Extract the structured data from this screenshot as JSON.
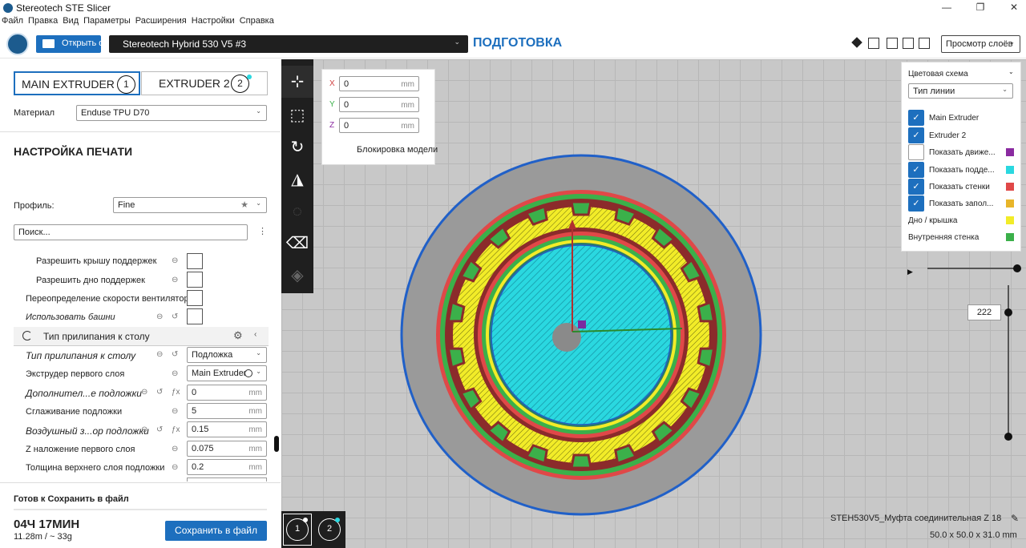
{
  "window": {
    "title": "Stereotech STE Slicer",
    "minimize": "—",
    "maximize": "❐",
    "close": "✕"
  },
  "menu": [
    "Файл",
    "Правка",
    "Вид",
    "Параметры",
    "Расширения",
    "Настройки",
    "Справка"
  ],
  "header": {
    "open_label": "Открыть фа",
    "printer": "Stereotech Hybrid 530 V5 #3",
    "stage": "ПОДГОТОВКА",
    "layer_view": "Просмотр слоёв"
  },
  "extruders": {
    "main": "MAIN EXTRUDER",
    "main_num": "1",
    "second": "EXTRUDER 2",
    "second_num": "2"
  },
  "material": {
    "label": "Материал",
    "value": "Enduse TPU D70"
  },
  "print_settings": {
    "title": "НАСТРОЙКА ПЕЧАТИ",
    "profile_label": "Профиль:",
    "profile_value": "Fine",
    "search_placeholder": "Поиск..."
  },
  "settings": [
    {
      "label": "Разрешить крышу поддержек"
    },
    {
      "label": "Разрешить дно поддержек"
    },
    {
      "label": "Переопределение скорости вентилятора"
    },
    {
      "label": "Использовать башни"
    }
  ],
  "adhesion": {
    "section_title": "Тип прилипания к столу",
    "rows": [
      {
        "label": "Тип прилипания к столу",
        "value": "Подложка"
      },
      {
        "label": "Экструдер первого слоя",
        "value": "Main Extruder"
      },
      {
        "label": "Дополнител...е подложки",
        "value": "0",
        "unit": "mm"
      },
      {
        "label": "Сглаживание подложки",
        "value": "5",
        "unit": "mm"
      },
      {
        "label": "Воздушный з...ор подложки",
        "value": "0.15",
        "unit": "mm"
      },
      {
        "label": "Z наложение первого слоя",
        "value": "0.075",
        "unit": "mm"
      },
      {
        "label": "Толщина верхнего слоя подложки",
        "value": "0.2",
        "unit": "mm"
      }
    ]
  },
  "bottom": {
    "status": "Готов к Сохранить в файл",
    "time": "04Ч 17МИН",
    "material": "11.28m / ~ 33g",
    "save_label": "Сохранить в файл"
  },
  "move": {
    "x_label": "X",
    "y_label": "Y",
    "z_label": "Z",
    "x": "0",
    "y": "0",
    "z": "0",
    "unit": "mm",
    "lock_label": "Блокировка модели"
  },
  "color_panel": {
    "title": "Цветовая схема",
    "scheme": "Тип линии",
    "items": [
      {
        "label": "Main Extruder",
        "checked": true,
        "color": ""
      },
      {
        "label": "Extruder 2",
        "checked": true,
        "color": ""
      },
      {
        "label": "Показать движе...",
        "checked": false,
        "color": "#8a2aa0"
      },
      {
        "label": "Показать подде...",
        "checked": true,
        "color": "#2ad8e0"
      },
      {
        "label": "Показать стенки",
        "checked": true,
        "color": "#e04848"
      },
      {
        "label": "Показать запол...",
        "checked": true,
        "color": "#e8b52a"
      },
      {
        "label": "Дно / крышка",
        "checked": false,
        "color": "#f2ec28"
      },
      {
        "label": "Внутренняя стенка",
        "checked": false,
        "color": "#3bb04a"
      }
    ]
  },
  "layer": {
    "current": "222"
  },
  "model": {
    "name": "STEH530V5_Муфта соединительная Z 18",
    "dims": "50.0 x 50.0 x 31.0 mm"
  },
  "ext_selector": {
    "first": "1",
    "second": "2"
  },
  "colors": {
    "accent": "#1d6fbe",
    "support": "#2ad8e0",
    "wall": "#e04848",
    "infill": "#e8b52a",
    "skin": "#f2ec28",
    "inner_wall": "#3bb04a",
    "outer_wall": "#8b2b2b",
    "brim": "#9a9a9a",
    "bed_outline": "#2060c8"
  }
}
